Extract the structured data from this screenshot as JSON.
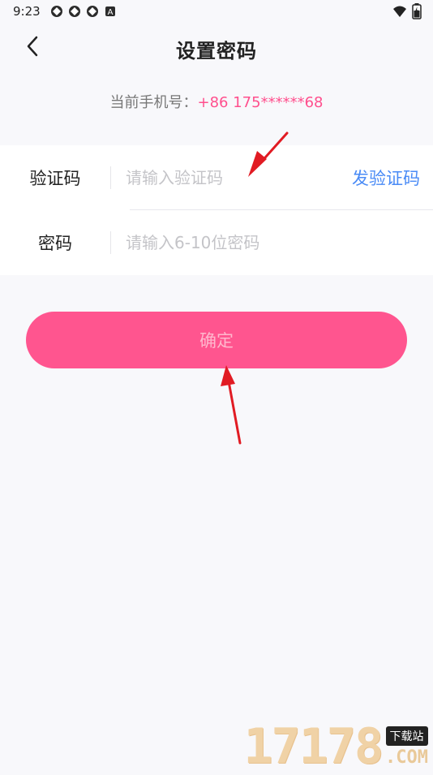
{
  "status_bar": {
    "time": "9:23",
    "left_icons": [
      "notification-icon",
      "notification-icon",
      "notification-icon",
      "a-badge-icon"
    ],
    "right_icons": [
      "wifi-icon",
      "battery-icon"
    ]
  },
  "header": {
    "title": "设置密码",
    "back_icon": "chevron-left-icon"
  },
  "phone": {
    "prefix": "当前手机号：",
    "value": "+86  175******68"
  },
  "form": {
    "code_label": "验证码",
    "code_placeholder": "请输入验证码",
    "send_code": "发验证码",
    "password_label": "密码",
    "password_placeholder": "请输入6-10位密码"
  },
  "confirm_button": {
    "label": "确定"
  },
  "watermark": {
    "numbers": "17178",
    "tag": "下载站",
    "domain": ".COM"
  },
  "colors": {
    "accent_pink": "#ff558f",
    "link_blue": "#4a8bf6",
    "annotation_red": "#e11b23"
  }
}
